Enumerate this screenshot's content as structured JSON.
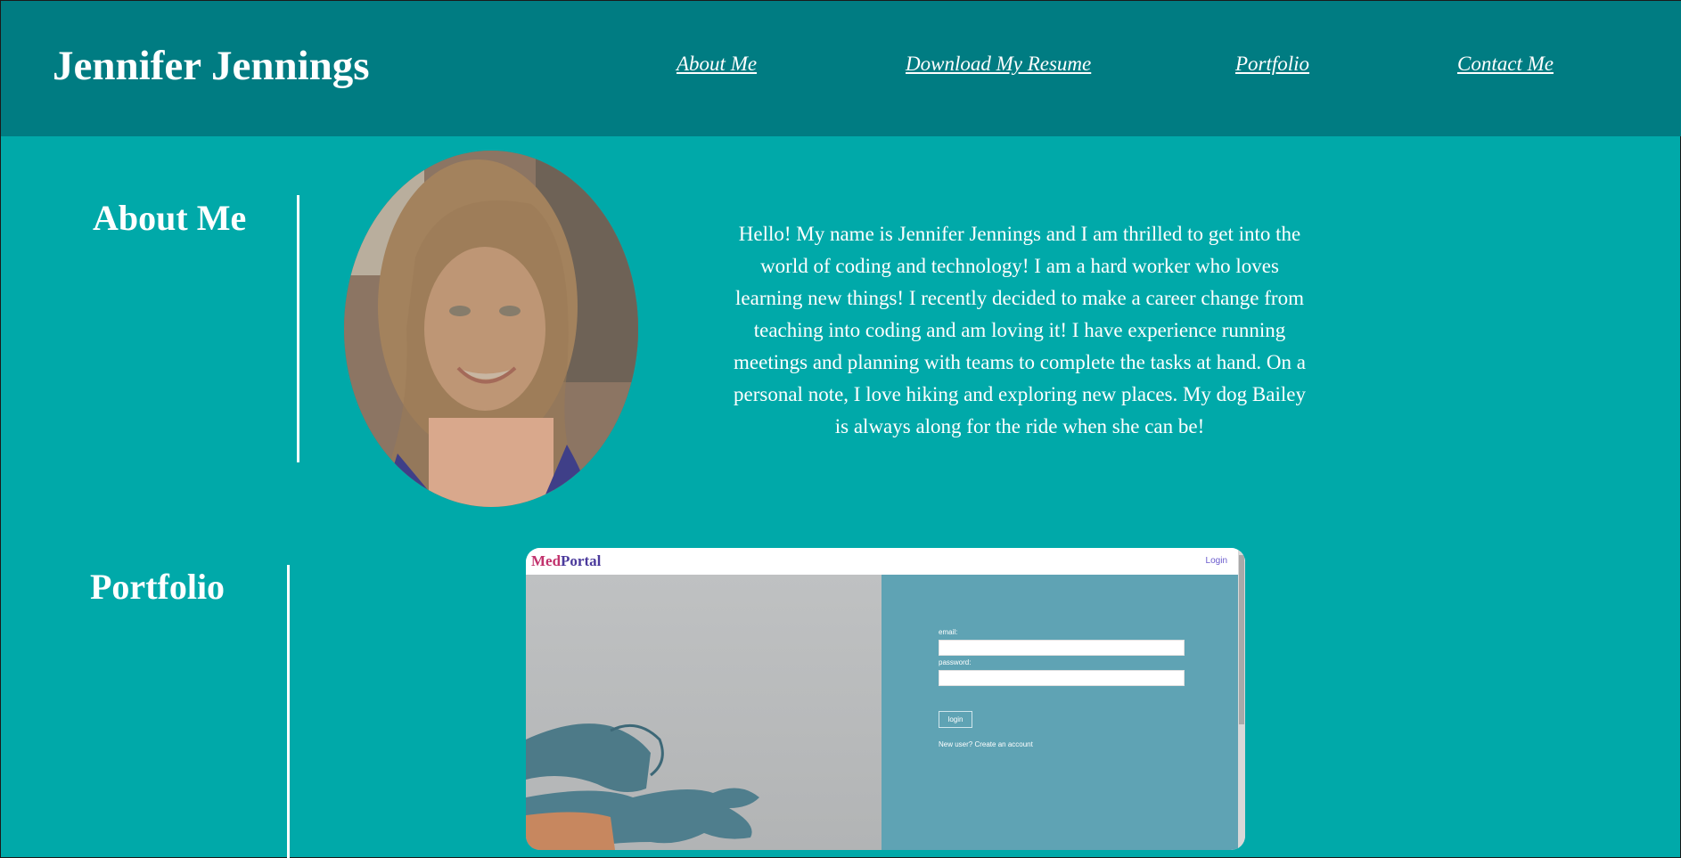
{
  "header": {
    "title": "Jennifer Jennings",
    "nav": [
      "About Me",
      "Download My Resume",
      "Portfolio",
      "Contact Me"
    ]
  },
  "about": {
    "heading": "About Me",
    "bio": "Hello! My name is Jennifer Jennings and I am thrilled to get into the world of coding and technology! I am a hard worker who loves learning new things! I recently decided to make a career change from teaching into coding and am loving it! I have experience running meetings and planning with teams to complete the tasks at hand. On a personal note, I love hiking and exploring new places. My dog Bailey is always along for the ride when she can be!"
  },
  "portfolio": {
    "heading": "Portfolio",
    "project": {
      "logo_part1": "Med",
      "logo_part2": "Portal",
      "login_link": "Login",
      "email_label": "email:",
      "password_label": "password:",
      "login_button": "login",
      "new_user_text": "New user? Create an account"
    }
  },
  "colors": {
    "page_bg": "#00a9a9",
    "header_bg": "#007c82",
    "text": "#ffffff"
  }
}
